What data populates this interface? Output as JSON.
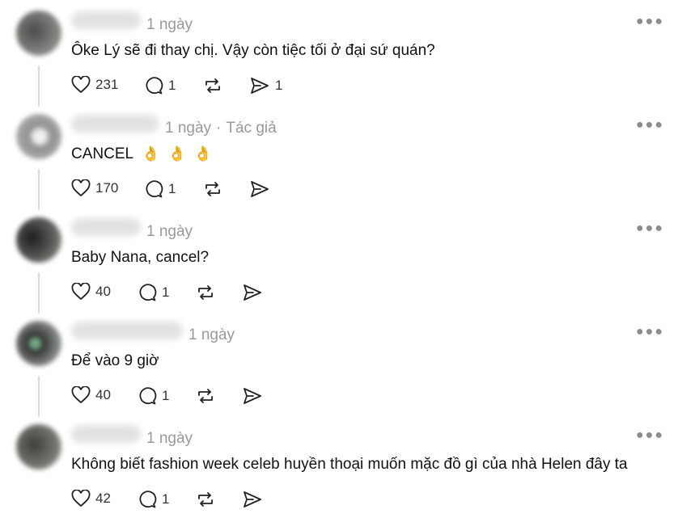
{
  "posts": [
    {
      "time": "1 ngày",
      "author_tag": "",
      "text": "Ôke Lý sẽ đi thay chị. Vậy còn tiệc tối ở đại sứ quán?",
      "emojis": [],
      "likes": "231",
      "replies": "1",
      "reposts": "",
      "shares": "1",
      "avatar_color": "#6e6f6c"
    },
    {
      "time": "1 ngày",
      "author_tag": "Tác giả",
      "text": "CANCEL",
      "emojis": [
        "👌",
        "👌",
        "👌"
      ],
      "likes": "170",
      "replies": "1",
      "reposts": "",
      "shares": "",
      "avatar_color": "#8a8d8a"
    },
    {
      "time": "1 ngày",
      "author_tag": "",
      "text": "Baby Nana, cancel?",
      "emojis": [],
      "likes": "40",
      "replies": "1",
      "reposts": "",
      "shares": "",
      "avatar_color": "#4d4d4c"
    },
    {
      "time": "1 ngày",
      "author_tag": "",
      "text": "Để vào 9 giờ",
      "emojis": [],
      "likes": "40",
      "replies": "1",
      "reposts": "",
      "shares": "",
      "avatar_color": "#5f6764"
    },
    {
      "time": "1 ngày",
      "author_tag": "",
      "text": "Không biết fashion week celeb huyền thoại muốn mặc đồ gì của nhà Helen đây ta",
      "emojis": [],
      "likes": "42",
      "replies": "1",
      "reposts": "",
      "shares": "",
      "avatar_color": "#5a5955"
    }
  ],
  "icons": {
    "like": "heart-icon",
    "reply": "comment-icon",
    "repost": "repost-icon",
    "share": "send-icon",
    "more": "more-options-icon"
  }
}
